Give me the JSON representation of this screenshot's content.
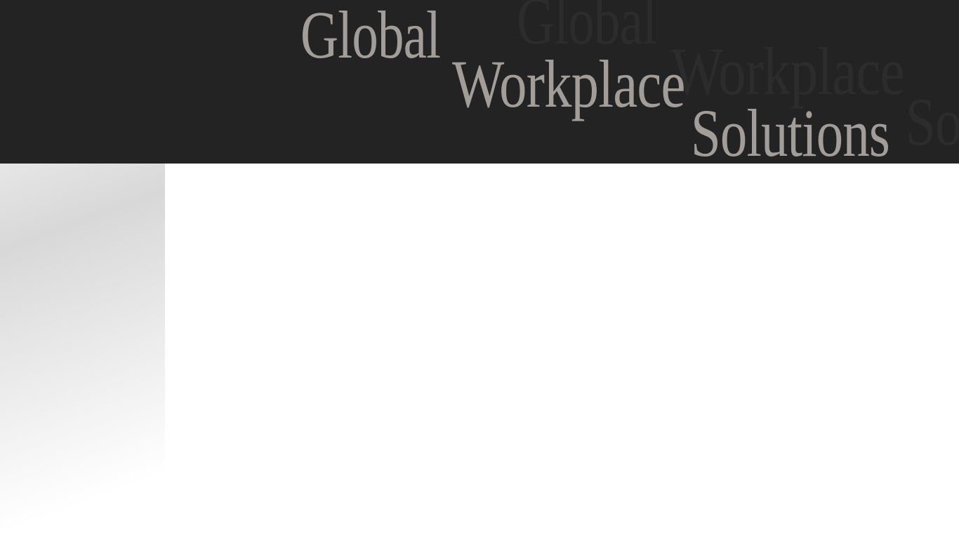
{
  "header": {
    "title_words": [
      "Global",
      "Workplace",
      "Solutions"
    ],
    "echo_words": [
      "Global",
      "Workplace",
      "Solutions"
    ],
    "background_color": "#232323",
    "text_color": "#a29d98",
    "echo_color": "#2c2c2c"
  },
  "side_panel": {
    "gradient_colors": [
      "#d8d8d8",
      "#ffffff"
    ]
  },
  "content": {
    "background_color": "#ffffff"
  }
}
